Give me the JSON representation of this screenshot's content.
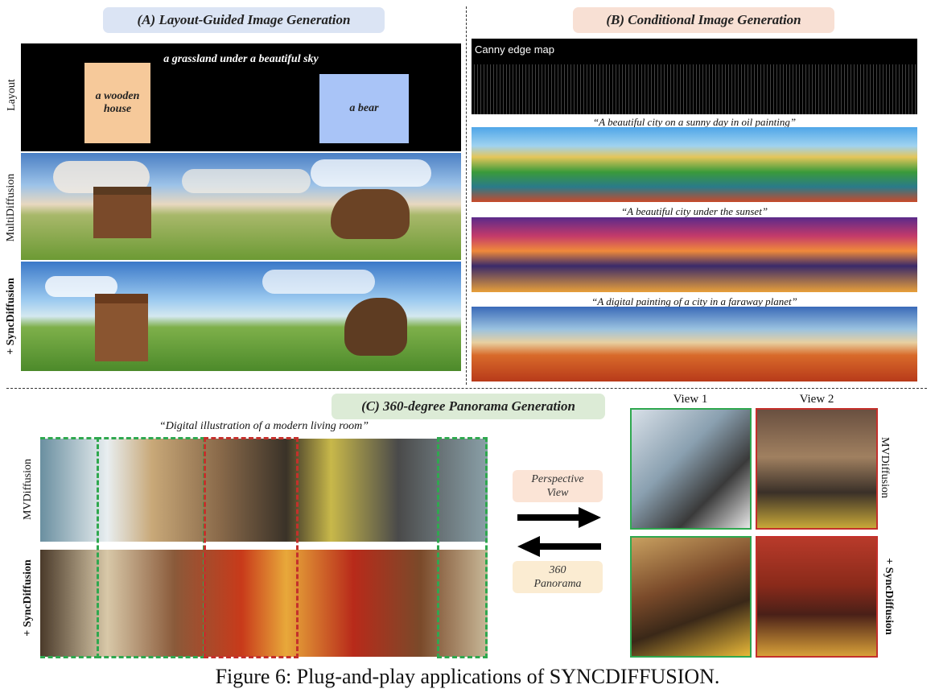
{
  "sectionA": {
    "title": "(A) Layout-Guided Image Generation",
    "row_labels": {
      "layout": "Layout",
      "multidiffusion": "MultiDiffusion",
      "sync": "+ SyncDiffusion"
    },
    "layout_prompt": "a grassland under a beautiful sky",
    "box1": "a wooden house",
    "box2": "a bear"
  },
  "sectionB": {
    "title": "(B) Conditional Image Generation",
    "canny_label": "Canny edge map",
    "captions": [
      "“A beautiful city on a sunny day in oil painting”",
      "“A beautiful city under the sunset”",
      "“A digital painting of a city in a faraway planet”"
    ]
  },
  "sectionC": {
    "title": "(C) 360-degree Panorama Generation",
    "prompt": "“Digital illustration of a modern living room”",
    "row_labels": {
      "mvdiffusion": "MVDiffusion",
      "sync": "+ SyncDiffusion"
    },
    "perspective_view": "Perspective View",
    "panorama_360": "360 Panorama",
    "view1": "View 1",
    "view2": "View 2",
    "right_labels": {
      "mvdiffusion": "MVDiffusion",
      "sync": "+ SyncDiffusion"
    }
  },
  "figure_caption": "Figure 6:  Plug-and-play applications of SYNCDIFFUSION.",
  "colors": {
    "pillA": "#dbe4f4",
    "pillB": "#f8e0d4",
    "pillC": "#dcebd6",
    "box1": "#f6c99a",
    "box2": "#a9c4f7",
    "green": "#2fa84f",
    "red": "#c4302b"
  }
}
